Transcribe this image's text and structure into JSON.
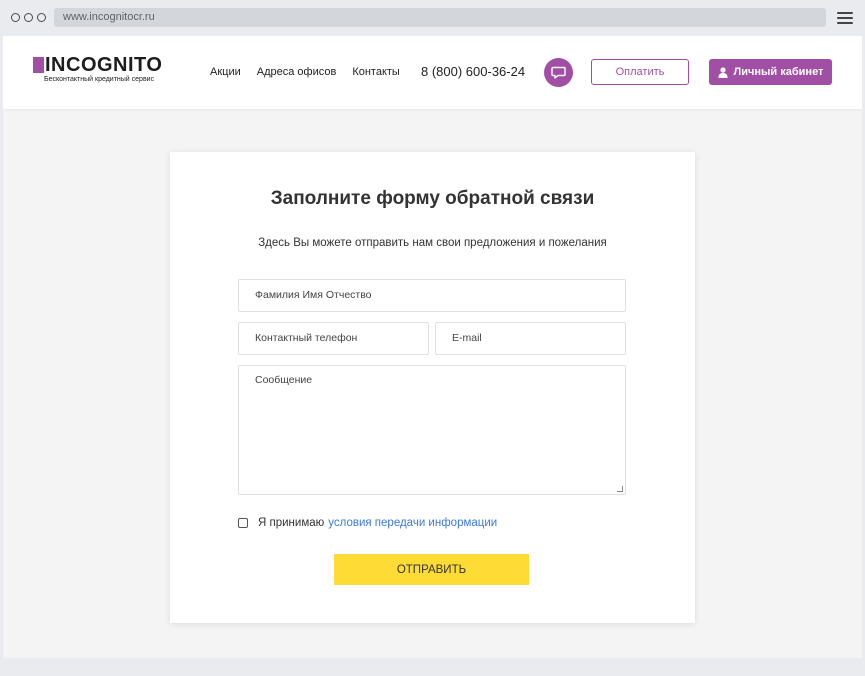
{
  "browser": {
    "url": "www.incognitocr.ru"
  },
  "header": {
    "logo_text": "INCOGNITO",
    "logo_subtitle": "Бесконтактный кредитный сервис",
    "nav": [
      "Акции",
      "Адреса офисов",
      "Контакты"
    ],
    "phone": "8 (800) 600-36-24",
    "pay_label": "Оплатить",
    "cabinet_label": "Личный кабинет"
  },
  "form": {
    "title": "Заполните форму обратной связи",
    "subtitle": "Здесь Вы можете отправить нам свои предложения и пожелания",
    "name_placeholder": "Фамилия Имя Отчество",
    "phone_placeholder": "Контактный телефон",
    "email_placeholder": "E-mail",
    "message_placeholder": "Сообщение",
    "consent_text": "Я принимаю",
    "consent_link": "условия передачи информации",
    "submit_label": "ОТПРАВИТЬ"
  },
  "colors": {
    "brand": "#a14ea5",
    "submit": "#fedb35",
    "link": "#3c7bd4"
  },
  "icons": {
    "chat": "chat-bubble-icon",
    "user": "user-icon",
    "menu": "hamburger-menu-icon"
  }
}
